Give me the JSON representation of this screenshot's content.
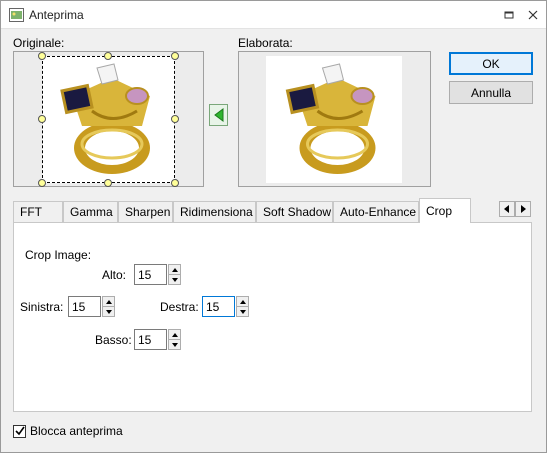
{
  "window": {
    "title": "Anteprima"
  },
  "preview": {
    "original_label": "Originale:",
    "processed_label": "Elaborata:",
    "apply_arrow": "arrow-left-icon"
  },
  "buttons": {
    "ok": "OK",
    "cancel": "Annulla"
  },
  "tabs": [
    {
      "label": "FFT"
    },
    {
      "label": "Gamma"
    },
    {
      "label": "Sharpen"
    },
    {
      "label": "Ridimensiona"
    },
    {
      "label": "Soft Shadow"
    },
    {
      "label": "Auto-Enhance"
    },
    {
      "label": "Crop",
      "active": true
    }
  ],
  "crop": {
    "heading": "Crop Image:",
    "alto_label": "Alto:",
    "alto_value": "15",
    "sinistra_label": "Sinistra:",
    "sinistra_value": "15",
    "destra_label": "Destra:",
    "destra_value": "15",
    "basso_label": "Basso:",
    "basso_value": "15"
  },
  "lock_preview": {
    "label": "Blocca anteprima",
    "checked": true
  },
  "colors": {
    "accent": "#0078d7",
    "arrow_green": "#2fb52f",
    "ring_gold": "#d9b53a"
  }
}
